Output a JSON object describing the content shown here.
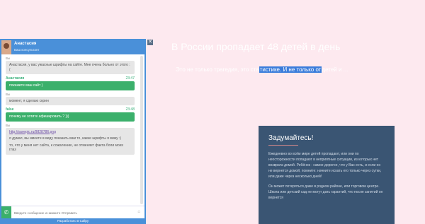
{
  "hero": {
    "title": "В России пропадает 48 детей в день",
    "sub_pre": "Это не только трагедия, это ста",
    "sub_highlight": "тистике. И не только от",
    "sub_post": "детей и ..."
  },
  "chat": {
    "close_glyph": "✕",
    "operator_name": "Анастасия",
    "operator_role": "Ваш консультант",
    "messages": [
      {
        "type": "in",
        "author": "Вы",
        "time": "",
        "lines": [
          "Анастасия, у вас ужасные шрифты на сайте. Мне очень больно от этого :("
        ]
      },
      {
        "type": "out",
        "author": "Анастасия",
        "time": "23:47",
        "lines": [
          "покажите ваш сайт )"
        ]
      },
      {
        "type": "in",
        "author": "Вы",
        "time": "",
        "lines": [
          "момент, я сделаю скрин"
        ]
      },
      {
        "type": "out",
        "author": "false",
        "time": "23:48",
        "lines": [
          "почему не хотите афишировать ? )))"
        ]
      },
      {
        "type": "in",
        "author": "Вы",
        "time": "",
        "link": "http://savepic.ru/9828786.png",
        "lines": [
          "я думал, вы имеете в виду показать вам то, какие шрифты я вижу :)",
          "то, что у меня нет сайта, к сожалению, не отменяет факта боли моих глаз"
        ]
      }
    ],
    "input_placeholder": "Введите сообщение и нажмите Отправить",
    "attach_glyph": "⌂",
    "phone_glyph": "✆",
    "footer": "Разработано в Callpy"
  },
  "card": {
    "title": "Задумайтесь!",
    "p1": "Ежедневно во всём мире детей пропадают, или они по неосторожности попадают в неприятные ситуации, из которых нет возврата домой. Ребёнок - самое дорогое, что у Вас есть, и если он не вернется домой, помните: начните искать его только через сутки, или даже через несколько дней!",
    "p2": "Он может потеряться даже в родном районе, или торговом центре. Школа или детский сад не могут дать гарантий, что после занятий он вернется"
  },
  "colors": {
    "background": "#fde9ef",
    "chat_accent": "#4a90d9",
    "bubble_out": "#3bb06b",
    "card_bg": "#3a5573"
  }
}
